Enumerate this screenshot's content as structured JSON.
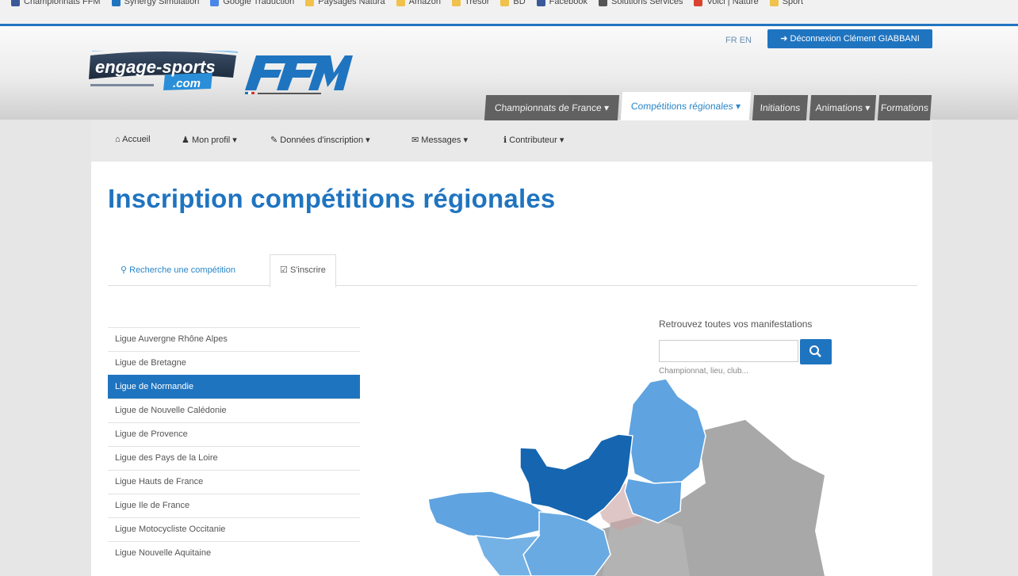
{
  "bookmarks": [
    {
      "label": "Championnats FFM",
      "icon": "facebook-icon",
      "color": "#3b5998"
    },
    {
      "label": "Synergy Simulation",
      "icon": "bookmark-icon",
      "color": "#1f74c0"
    },
    {
      "label": "Google Traduction",
      "icon": "translate-icon",
      "color": "#4a86e8"
    },
    {
      "label": "Paysages Natura",
      "icon": "folder-icon",
      "color": "#f0c24b"
    },
    {
      "label": "Amazon",
      "icon": "folder-icon",
      "color": "#f0c24b"
    },
    {
      "label": "Trésor",
      "icon": "folder-icon",
      "color": "#f0c24b"
    },
    {
      "label": "BD",
      "icon": "folder-icon",
      "color": "#f0c24b"
    },
    {
      "label": "Facebook",
      "icon": "facebook-icon",
      "color": "#3b5998"
    },
    {
      "label": "Solutions Services",
      "icon": "globe-icon",
      "color": "#555555"
    },
    {
      "label": "Voici | Nature",
      "icon": "bookmark-icon",
      "color": "#d9432f"
    },
    {
      "label": "Sport",
      "icon": "folder-icon",
      "color": "#f0c24b"
    }
  ],
  "header": {
    "logo_text": "engage-sports.com",
    "logo_ffm": "FFM",
    "languages": "FR EN",
    "logout_label": "Déconnexion Clément GIABBANI",
    "tabs": [
      {
        "label": "Championnats de France ▾"
      },
      {
        "label": "Compétitions régionales ▾",
        "active": true
      },
      {
        "label": "Initiations"
      },
      {
        "label": "Animations ▾"
      },
      {
        "label": "Formations"
      }
    ]
  },
  "nav": [
    {
      "icon": "home-icon",
      "label": "Accueil"
    },
    {
      "icon": "user-icon",
      "label": "Mon profil ▾"
    },
    {
      "icon": "pencil-icon",
      "label": "Données d'inscription ▾"
    },
    {
      "icon": "envelope-icon",
      "label": "Messages ▾"
    },
    {
      "icon": "info-icon",
      "label": "Contributeur ▾"
    }
  ],
  "page": {
    "title": "Inscription compétitions régionales",
    "tabs": [
      {
        "icon": "search-icon",
        "label": "Recherche une compétition"
      },
      {
        "icon": "edit-icon",
        "label": "S'inscrire",
        "active": true
      }
    ]
  },
  "leagues": [
    {
      "label": "Ligue Auvergne Rhône Alpes"
    },
    {
      "label": "Ligue de Bretagne"
    },
    {
      "label": "Ligue de Normandie",
      "active": true
    },
    {
      "label": "Ligue de Nouvelle Calédonie"
    },
    {
      "label": "Ligue de Provence"
    },
    {
      "label": "Ligue des Pays de la Loire"
    },
    {
      "label": "Ligue Hauts de France"
    },
    {
      "label": "Ligue Ile de France"
    },
    {
      "label": "Ligue Motocycliste Occitanie"
    },
    {
      "label": "Ligue Nouvelle Aquitaine"
    }
  ],
  "search": {
    "label": "Retrouvez toutes vos manifestations",
    "placeholder": "",
    "hint": "Championnat, lieu, club..."
  },
  "colors": {
    "accent": "#1f74c0",
    "region_selected": "#1565b0",
    "region_available": "#5fa3e0",
    "region_unavailable": "#a8a8a8"
  }
}
